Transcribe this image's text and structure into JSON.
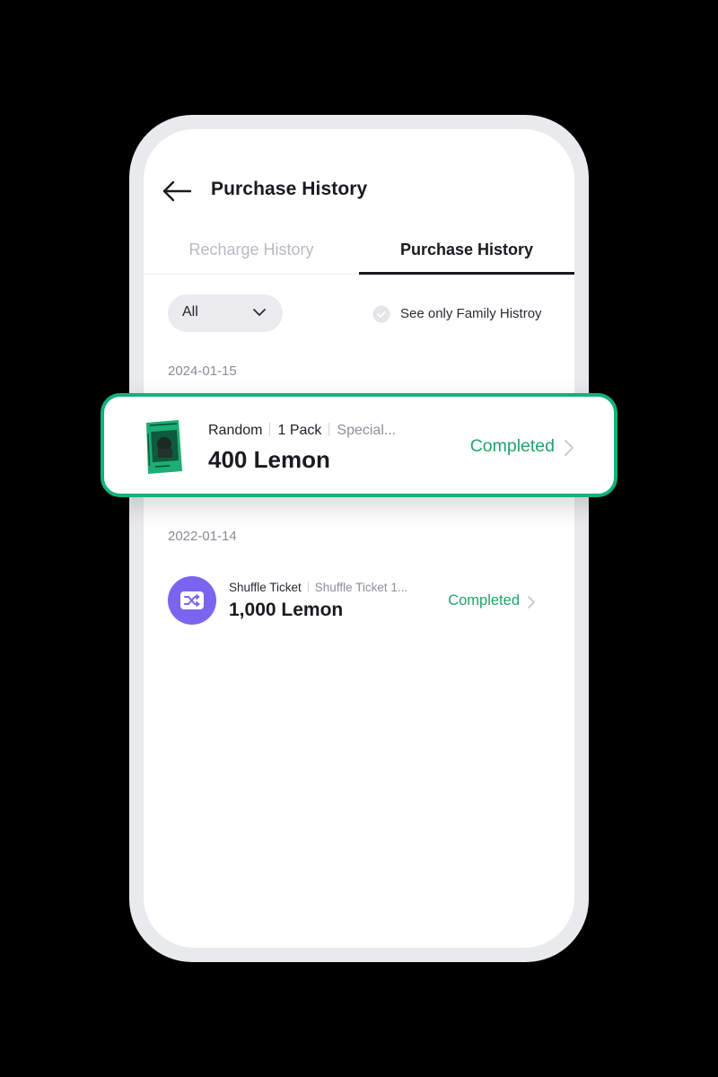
{
  "header": {
    "title": "Purchase History"
  },
  "tabs": [
    {
      "label": "Recharge History",
      "active": false
    },
    {
      "label": "Purchase History",
      "active": true
    }
  ],
  "filters": {
    "select_value": "All",
    "family_toggle_label": "See only Family Histroy"
  },
  "groups": [
    {
      "date": "2024-01-15",
      "items": [
        {
          "name": "Random",
          "quantity": "1 Pack",
          "detail": "Special...",
          "amount": "400 Lemon",
          "status": "Completed",
          "icon": "album-cover-thumbnail"
        }
      ]
    },
    {
      "date": "2022-01-14",
      "items": [
        {
          "name": "Shuffle Ticket",
          "detail": "Shuffle Ticket 1...",
          "amount": "1,000 Lemon",
          "status": "Completed",
          "icon": "shuffle-icon"
        }
      ]
    }
  ],
  "colors": {
    "accent_green": "#12b27a",
    "status_green": "#1fa36b",
    "shuffle_purple": "#7b64f0",
    "backdrop": "#000000"
  }
}
